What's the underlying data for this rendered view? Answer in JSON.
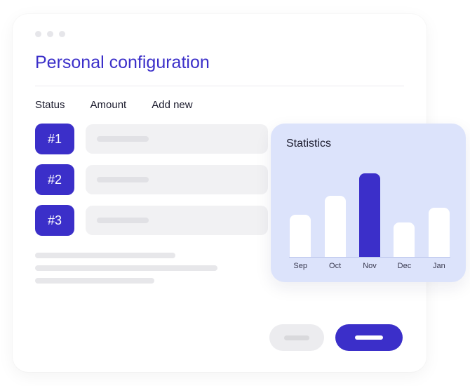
{
  "header": {
    "title": "Personal configuration"
  },
  "columns": {
    "status": "Status",
    "amount": "Amount",
    "add_new": "Add new"
  },
  "rows": [
    {
      "badge": "#1"
    },
    {
      "badge": "#2"
    },
    {
      "badge": "#3"
    }
  ],
  "stats": {
    "title": "Statistics"
  },
  "chart_data": {
    "type": "bar",
    "categories": [
      "Sep",
      "Oct",
      "Nov",
      "Dec",
      "Jan"
    ],
    "values": [
      55,
      80,
      110,
      45,
      65
    ],
    "highlight_index": 2,
    "title": "Statistics",
    "xlabel": "",
    "ylabel": "",
    "ylim": [
      0,
      120
    ]
  }
}
